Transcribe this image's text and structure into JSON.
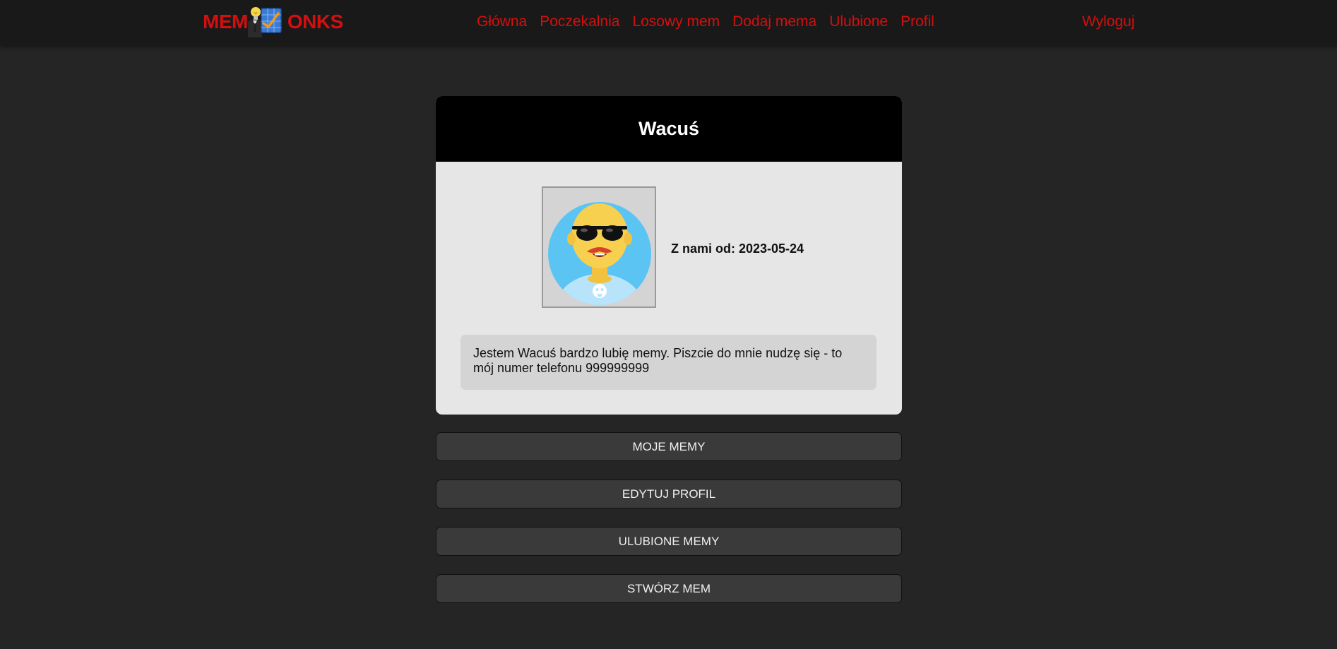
{
  "nav": {
    "logo_left": "MEM",
    "logo_right": "ONKS",
    "links": [
      "Główna",
      "Poczekalnia",
      "Losowy mem",
      "Dodaj mema",
      "Ulubione",
      "Profil"
    ],
    "logout": "Wyloguj",
    "link_color": "#d40f0f"
  },
  "profile": {
    "username": "Wacuś",
    "joined": "Z nami od: 2023-05-24",
    "bio": "Jestem Wacuś bardzo lubię memy. Piszcie do mnie nudzę się - to mój numer telefonu 999999999"
  },
  "buttons": {
    "my_memes": "MOJE MEMY",
    "edit_profile": "EDYTUJ PROFIL",
    "favorite_memes": "ULUBIONE MEMY",
    "create_meme": "STWÓRZ MEM"
  },
  "icons": {
    "logo": "bulb-suit-chart-logo-icon",
    "avatar": "bald-man-sunglasses-avatar-icon"
  }
}
